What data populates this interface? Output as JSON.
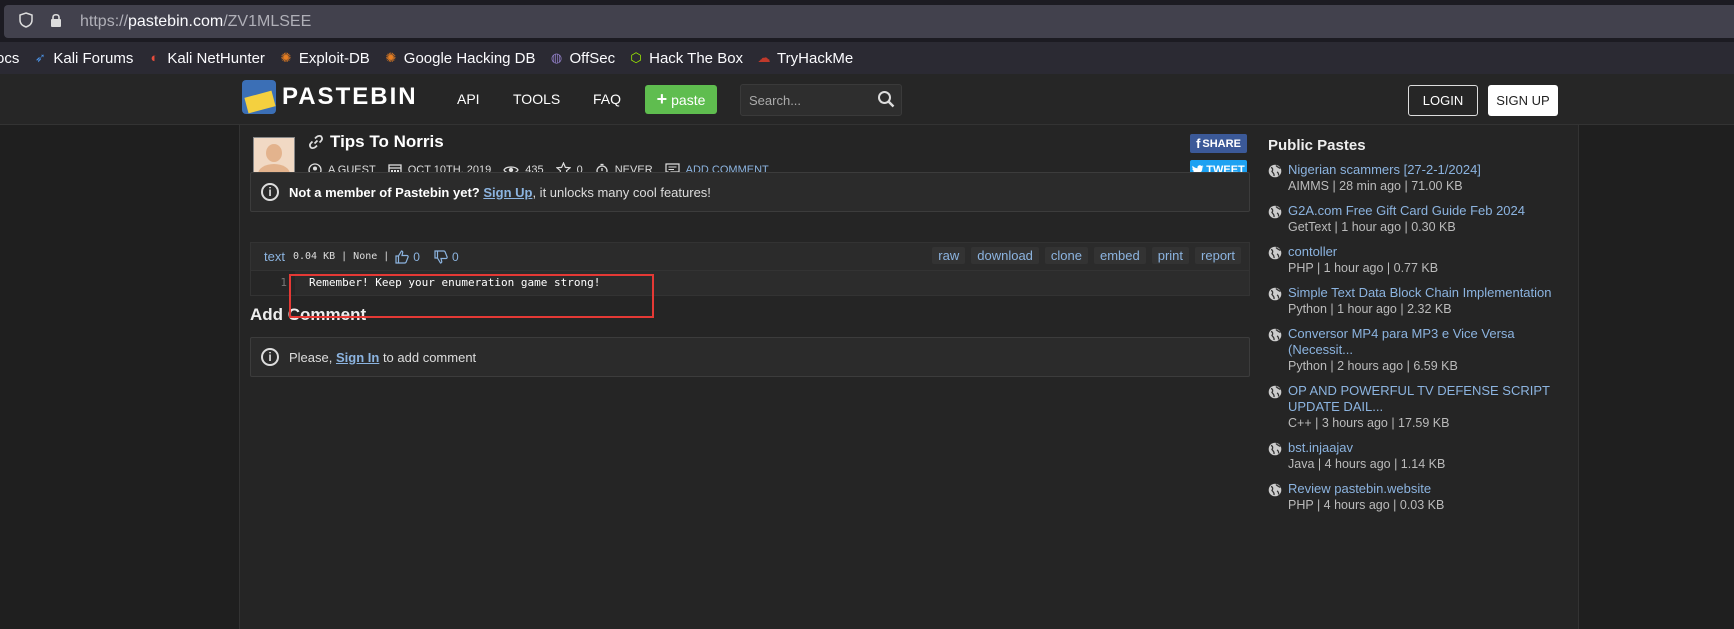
{
  "browser": {
    "url_prefix": "https://",
    "url_host": "pastebin.com",
    "url_path": "/ZV1MLSEE",
    "bookmarks": [
      "ocs",
      "Kali Forums",
      "Kali NetHunter",
      "Exploit-DB",
      "Google Hacking DB",
      "OffSec",
      "Hack The Box",
      "TryHackMe"
    ]
  },
  "header": {
    "logo_text": "PASTEBIN",
    "nav": [
      "API",
      "TOOLS",
      "FAQ"
    ],
    "paste_label": "paste",
    "search_placeholder": "Search...",
    "login_label": "LOGIN",
    "signup_label": "SIGN UP"
  },
  "paste": {
    "title": "Tips To Norris",
    "author": "A GUEST",
    "date": "OCT 10TH, 2019",
    "views": "435",
    "stars": "0",
    "expire": "NEVER",
    "add_comment": "ADD COMMENT",
    "share_label": "SHARE",
    "tweet_label": "TWEET",
    "syntax": "text",
    "size_info": "0.04 KB | None |",
    "likes": "0",
    "dislikes": "0",
    "actions": [
      "raw",
      "download",
      "clone",
      "embed",
      "print",
      "report"
    ],
    "line_number": "1",
    "line_content": "Remember! Keep your enumeration game strong!"
  },
  "notice": {
    "bold": "Not a member of Pastebin yet?",
    "link": "Sign Up",
    "rest": ", it unlocks many cool features!"
  },
  "comments": {
    "heading": "Add Comment",
    "prefix": "Please, ",
    "link": "Sign In",
    "suffix": " to add comment"
  },
  "sidebar": {
    "heading": "Public Pastes",
    "items": [
      {
        "title": "Nigerian scammers [27-2-1/2024]",
        "meta": "AIMMS | 28 min ago | 71.00 KB"
      },
      {
        "title": "G2A.com Free Gift Card Guide Feb 2024",
        "meta": "GetText | 1 hour ago | 0.30 KB"
      },
      {
        "title": "contoller",
        "meta": "PHP | 1 hour ago | 0.77 KB"
      },
      {
        "title": "Simple Text Data Block Chain Implementation",
        "meta": "Python | 1 hour ago | 2.32 KB"
      },
      {
        "title": "Conversor MP4 para MP3 e Vice Versa (Necessit...",
        "meta": "Python | 2 hours ago | 6.59 KB"
      },
      {
        "title": "OP AND POWERFUL TV DEFENSE SCRIPT UPDATE DAIL...",
        "meta": "C++ | 3 hours ago | 17.59 KB"
      },
      {
        "title": "bst.injaajav",
        "meta": "Java | 4 hours ago | 1.14 KB"
      },
      {
        "title": "Review pastebin.website",
        "meta": "PHP | 4 hours ago | 0.03 KB"
      }
    ]
  }
}
